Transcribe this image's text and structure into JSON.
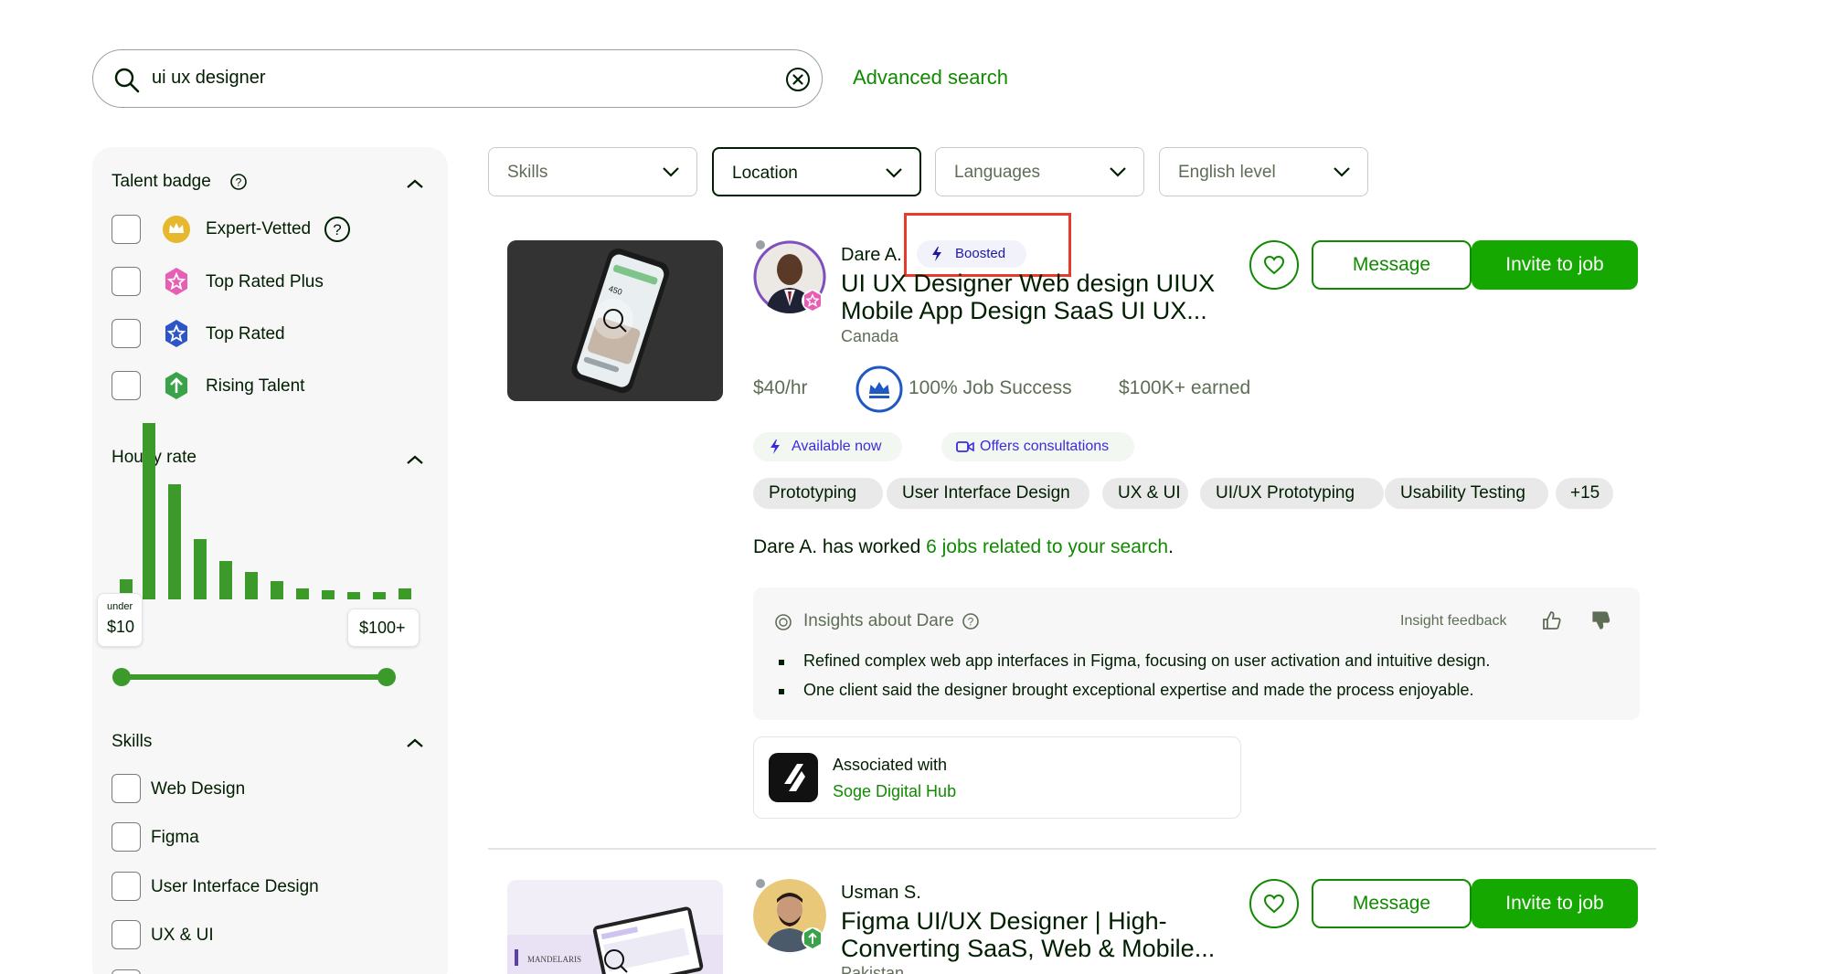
{
  "search": {
    "query": "ui ux designer",
    "advanced_label": "Advanced search"
  },
  "sidebar": {
    "talent_badge": {
      "title": "Talent badge",
      "items": [
        {
          "label": "Expert-Vetted",
          "icon": "expert-vetted-badge-icon"
        },
        {
          "label": "Top Rated Plus",
          "icon": "top-rated-plus-badge-icon"
        },
        {
          "label": "Top Rated",
          "icon": "top-rated-badge-icon"
        },
        {
          "label": "Rising Talent",
          "icon": "rising-talent-badge-icon"
        }
      ]
    },
    "hourly_rate": {
      "title": "Hourly rate",
      "min_small": "under",
      "min_label": "$10",
      "max_label": "$100+"
    },
    "skills": {
      "title": "Skills",
      "items": [
        "Web Design",
        "Figma",
        "User Interface Design",
        "UX & UI"
      ]
    }
  },
  "filters": [
    {
      "label": "Skills"
    },
    {
      "label": "Location"
    },
    {
      "label": "Languages"
    },
    {
      "label": "English level"
    }
  ],
  "results": [
    {
      "name": "Dare A.",
      "boosted": "Boosted",
      "title_line1": "UI UX Designer Web design UIUX",
      "title_line2": "Mobile App Design SaaS UI UX...",
      "location": "Canada",
      "rate": "$40/hr",
      "job_success": "100% Job Success",
      "earned": "$100K+ earned",
      "available": "Available now",
      "consult": "Offers consultations",
      "skills": [
        "Prototyping",
        "User Interface Design",
        "UX & UI",
        "UI/UX Prototyping",
        "Usability Testing",
        "+15"
      ],
      "worked_prefix": "Dare A. has worked ",
      "worked_link": "6 jobs related to your search",
      "worked_suffix": ".",
      "insights_title": "Insights about Dare",
      "insight_feedback": "Insight feedback",
      "insights": [
        "Refined complex web app interfaces in Figma, focusing on user activation and intuitive design.",
        "One client said the designer brought exceptional expertise and made the process enjoyable."
      ],
      "assoc_label": "Associated with",
      "assoc_name": "Soge Digital Hub",
      "message": "Message",
      "invite": "Invite to job",
      "thumb_text": "450"
    },
    {
      "name": "Usman S.",
      "title_line1": "Figma UI/UX Designer | High-",
      "title_line2": "Converting SaaS, Web & Mobile...",
      "location": "Pakistan",
      "message": "Message",
      "invite": "Invite to job",
      "thumb_text": "MANDELARIS"
    }
  ],
  "colors": {
    "brand_green": "#14a800",
    "link_green": "#108a00",
    "highlight_red": "#e53b2c",
    "badge_gold": "#e6b82e",
    "badge_pink": "#e75fb5",
    "badge_blue": "#2e55c7",
    "badge_green": "#3aa34a"
  }
}
